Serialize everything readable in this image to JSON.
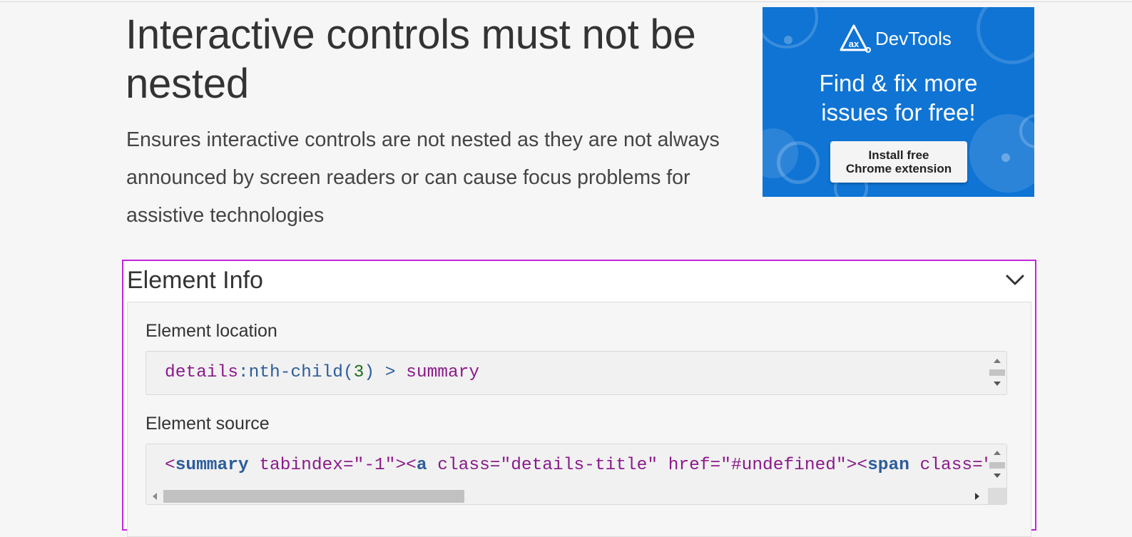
{
  "page": {
    "title": "Interactive controls must not be nested",
    "description": "Ensures interactive controls are not nested as they are not always announced by screen readers or can cause focus problems for assistive technologies"
  },
  "ad": {
    "brand": "DevTools",
    "logo_text": "ax",
    "headline_line1": "Find & fix more",
    "headline_line2": "issues for free!",
    "button_line1": "Install free",
    "button_line2": "Chrome extension",
    "background_color": "#0f74d4"
  },
  "element_info": {
    "title": "Element Info",
    "toggle_icon": "chevron-down-icon",
    "accent_color": "#c126d9",
    "location_label": "Element location",
    "location_code": {
      "selector": "details",
      "colon": ":",
      "pseudo": "nth-child(",
      "arg": "3",
      "close": ")",
      "combinator": " > ",
      "child": "summary"
    },
    "source_label": "Element source",
    "source_code": {
      "lt1": "<",
      "tag1": "summary",
      "attr1": " tabindex=\"-1\">",
      "lt2": "<",
      "tag2": "a",
      "attr2": " class=\"details-title\" href=\"#undefined\">",
      "lt3": "<",
      "tag3": "span",
      "attr3": " class=\""
    }
  }
}
